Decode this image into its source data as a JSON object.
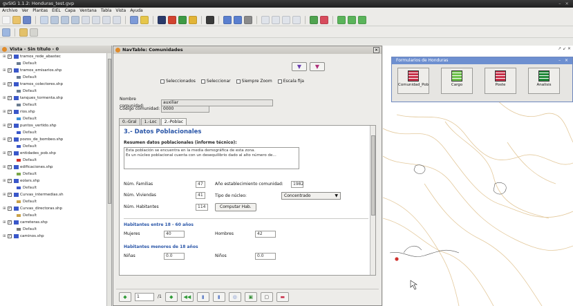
{
  "window": {
    "title": "gvSIG 1.1.2: Honduras_test.gvp",
    "controls": "– ×"
  },
  "menu": [
    "Archivo",
    "Ver",
    "Plantas",
    "EIEL",
    "Capa",
    "Ventana",
    "Tabla",
    "Vista",
    "Ayuda"
  ],
  "toc": {
    "title": "Vista - Sin título - 0",
    "layers": [
      {
        "name": "tramos_rede_abastec",
        "checked": true,
        "sub": "Default",
        "swatch": "#6b7c90"
      },
      {
        "name": "tramos_emisarios.shp",
        "checked": true,
        "sub": "Default",
        "swatch": "#6b7c90"
      },
      {
        "name": "tramos_colectores.shp",
        "checked": true,
        "sub": "Default",
        "swatch": "#6b7c90"
      },
      {
        "name": "tanques_tormenta.shp",
        "checked": true,
        "sub": "Default",
        "swatch": "#6b7c90"
      },
      {
        "name": "rios.shp",
        "checked": true,
        "sub": "Default",
        "swatch": "#3a8fd8"
      },
      {
        "name": "puntos_vertido.shp",
        "checked": true,
        "sub": "Default",
        "swatch": "#3a57c9"
      },
      {
        "name": "pozos_de_bombeo.shp",
        "checked": true,
        "sub": "Default",
        "swatch": "#3a57c9"
      },
      {
        "name": "entidades_pob.shp",
        "checked": true,
        "sub": "Default",
        "swatch": "#d0312d"
      },
      {
        "name": "edificaciones.shp",
        "checked": true,
        "sub": "Default",
        "swatch": "#7aa64a"
      },
      {
        "name": "eolars.shp",
        "checked": true,
        "sub": "Default",
        "swatch": "#3a57c9"
      },
      {
        "name": "Curvas_intermedias.sh",
        "checked": true,
        "sub": "Default",
        "swatch": "#c9a24a"
      },
      {
        "name": "Curvas_directoras.shp",
        "checked": true,
        "sub": "Default",
        "swatch": "#c9a24a"
      },
      {
        "name": "carreteras.shp",
        "checked": true,
        "sub": "Default",
        "swatch": "#777777"
      },
      {
        "name": "caminos.shp",
        "checked": true,
        "sub": "",
        "swatch": "#777777"
      }
    ]
  },
  "form": {
    "title": "NavTable: Comunidades",
    "options": [
      "Seleccionados",
      "Seleccionar",
      "Siempre Zoom",
      "Escala fija"
    ],
    "nombre_label": "Nombre comunidad:",
    "nombre_value": "auxiliar",
    "codigo_label": "Código comunidad:",
    "codigo_value": "0000",
    "tabs": [
      "0.-Gral",
      "1.-Loc",
      "2.-Poblac"
    ],
    "active_tab": 2,
    "section_title": "3.- Datos Poblacionales",
    "resumen_label": "Resumen datos poblacionales (informe técnico):",
    "resumen_text": "Esta población se encuentra en la media demográfica de esta zona.\nEs un núcleo poblacional cuenta con un desequilibrio dado al alto número de…",
    "familias_label": "Núm. Familias",
    "familias_value": "47",
    "anio_label": "Año establecimiento comunidad:",
    "anio_value": "1982",
    "viviendas_label": "Núm. Viviendas",
    "viviendas_value": "41",
    "tipo_label": "Tipo de núcleo:",
    "tipo_value": "Concentrado",
    "habitantes_label": "Núm. Habitantes",
    "habitantes_value": "114",
    "calc_button": "Computar Hab.",
    "group1": "Habitantes entre 18 - 60 años",
    "mujeres_label": "Mujeres",
    "mujeres_value": "40",
    "hombres_label": "Hombres",
    "hombres_value": "42",
    "group2": "Habitantes menores de 18 años",
    "ninas_label": "Niñas",
    "ninas_value": "0.0",
    "ninos_label": "Niños",
    "ninos_value": "0.0",
    "nav_position": "1",
    "nav_of": "/1"
  },
  "formularios": {
    "title": "Formularios de Honduras",
    "buttons": [
      "Comunidad_Pob",
      "Cargo",
      "Poste",
      "Analisis"
    ]
  },
  "map": {
    "controls": "↗ ↙ ✕"
  }
}
